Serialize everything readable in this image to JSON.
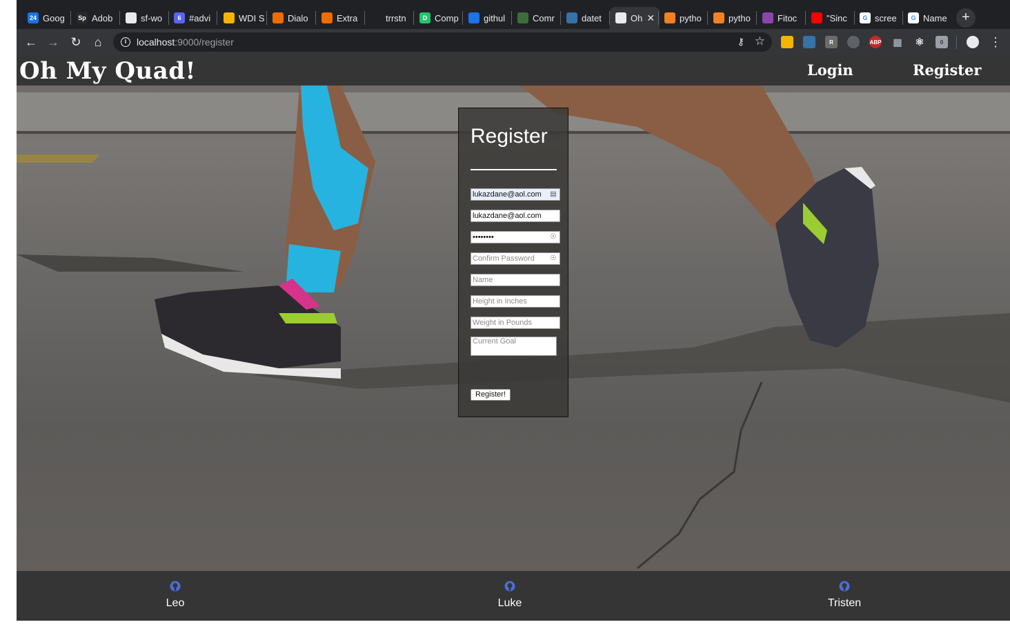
{
  "browser": {
    "tabs": [
      {
        "label": "Goog",
        "fav_icon": "google-calendar-icon",
        "fav_text": "24",
        "fav_color": "#1a73e8"
      },
      {
        "label": "Adob",
        "fav_icon": "adobe-spark-icon",
        "fav_text": "Sp",
        "fav_color": "#2a2a2a"
      },
      {
        "label": "sf-wo",
        "fav_icon": "github-icon",
        "fav_text": "",
        "fav_color": "#e8eaed"
      },
      {
        "label": "#advi",
        "fav_icon": "slack-icon",
        "fav_text": "6",
        "fav_color": "#5865f2"
      },
      {
        "label": "WDI S",
        "fav_icon": "google-slides-icon",
        "fav_text": "",
        "fav_color": "#f4b400"
      },
      {
        "label": "Dialo",
        "fav_icon": "dialogflow-icon",
        "fav_text": "",
        "fav_color": "#ef6c00"
      },
      {
        "label": "Extra",
        "fav_icon": "dialogflow-icon",
        "fav_text": "",
        "fav_color": "#ef6c00"
      },
      {
        "label": "trrstn",
        "fav_icon": "github-icon",
        "fav_text": "",
        "fav_color": "#202124"
      },
      {
        "label": "Comp",
        "fav_icon": "dash-icon",
        "fav_text": "D",
        "fav_color": "#21c56a"
      },
      {
        "label": "githul",
        "fav_icon": "flag-icon",
        "fav_text": "",
        "fav_color": "#1a73e8"
      },
      {
        "label": "Comr",
        "fav_icon": "chip-icon",
        "fav_text": "",
        "fav_color": "#3c6e3c"
      },
      {
        "label": "datet",
        "fav_icon": "python-icon",
        "fav_text": "",
        "fav_color": "#3572a5"
      },
      {
        "label": "Oh",
        "fav_icon": "document-icon",
        "fav_text": "",
        "fav_color": "#e8eaed"
      },
      {
        "label": "pytho",
        "fav_icon": "stackoverflow-icon",
        "fav_text": "",
        "fav_color": "#f48024"
      },
      {
        "label": "pytho",
        "fav_icon": "stackoverflow-icon",
        "fav_text": "",
        "fav_color": "#f48024"
      },
      {
        "label": "Fitoc",
        "fav_icon": "fitoc-icon",
        "fav_text": "",
        "fav_color": "#8e44ad"
      },
      {
        "label": "\"Sinc",
        "fav_icon": "youtube-icon",
        "fav_text": "",
        "fav_color": "#ff0000"
      },
      {
        "label": "scree",
        "fav_icon": "google-icon",
        "fav_text": "G",
        "fav_color": "#ffffff"
      },
      {
        "label": "Name",
        "fav_icon": "google-icon",
        "fav_text": "G",
        "fav_color": "#ffffff"
      }
    ],
    "active_tab_index": 12,
    "url_host": "localhost",
    "url_path": ":9000/register"
  },
  "site": {
    "brand": "Oh My Quad!",
    "nav": {
      "login": "Login",
      "register": "Register"
    }
  },
  "form": {
    "title": "Register",
    "email_value": "lukazdane@aol.com",
    "username_value": "lukazdane@aol.com",
    "password_value": "••••••••",
    "confirm_placeholder": "Confirm Password",
    "name_placeholder": "Name",
    "height_placeholder": "Height in Inches",
    "weight_placeholder": "Weight in Pounds",
    "goal_placeholder": "Current Goal",
    "submit_label": "Register!"
  },
  "footer": {
    "credits": [
      {
        "name": "Leo"
      },
      {
        "name": "Luke"
      },
      {
        "name": "Tristen"
      }
    ]
  },
  "colors": {
    "header_bg": "#353535",
    "tab_strip": "#202124",
    "toolbar": "#35363a",
    "github_icon": "#4a6ee0"
  }
}
